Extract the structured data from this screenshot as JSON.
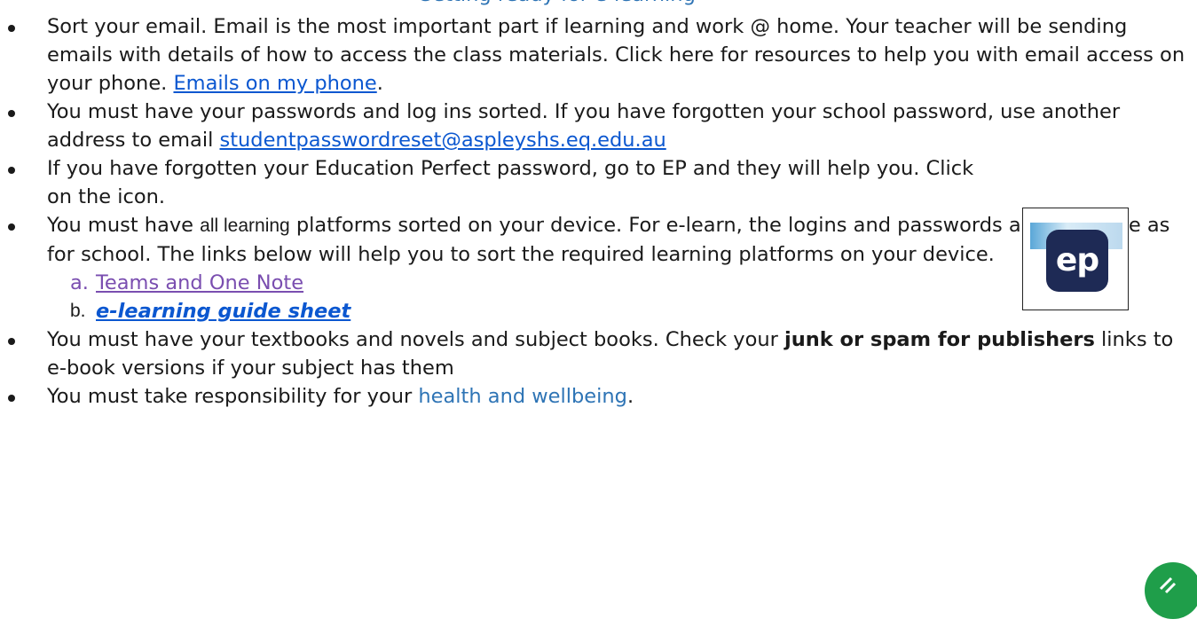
{
  "header_fragment": "Getting ready for e-learning",
  "items": [
    {
      "text": "Sort your email. Email is the most important part if learning and work @ home.  Your teacher will be sending emails with details of how to access the class materials. Click here for resources to help you with email access on your phone. ",
      "link": "Emails on my phone",
      "after": "."
    },
    {
      "text": "You must have your passwords and log ins sorted. If you have forgotten your school password, use another address to email ",
      "link": "studentpasswordreset@aspleyshs.eq.edu.au"
    },
    {
      "text": "If you have forgotten your Education Perfect password, go to EP and they will help you.  Click on the icon."
    },
    {
      "text_a": "You must have ",
      "text_sys": "all learning",
      "text_b": " platforms sorted on your device. For e-learn, the logins and passwords are the same as for school.  The links below will help you to sort the required learning platforms on your device.",
      "sub": [
        {
          "marker": "a.",
          "label": "Teams and One Note"
        },
        {
          "marker": "b.",
          "label": "e-learning guide sheet"
        }
      ]
    },
    {
      "text_a": "You must have your textbooks and novels and subject books. Check your ",
      "bold": "junk or spam for publishers",
      "text_b": " links to e-book versions if your subject has them"
    },
    {
      "text": "You must take responsibility for your ",
      "link": "health and wellbeing",
      "after": "."
    }
  ],
  "ep_icon": {
    "label": "ep",
    "bg": "#1e2a55"
  },
  "colors": {
    "link": "#0b57d0",
    "visited": "#7a4eb0",
    "heading": "#2e74b5",
    "icon_green": "#1f9e4a"
  }
}
